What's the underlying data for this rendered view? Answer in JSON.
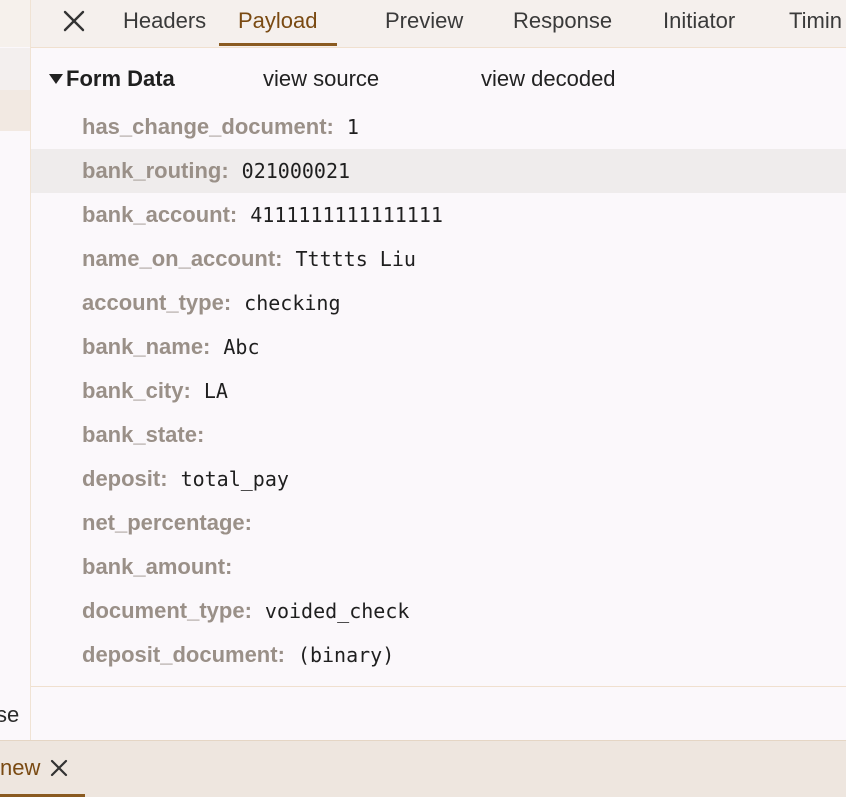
{
  "tabs": [
    {
      "label": "Headers",
      "active": false
    },
    {
      "label": "Payload",
      "active": true
    },
    {
      "label": "Preview",
      "active": false
    },
    {
      "label": "Response",
      "active": false
    },
    {
      "label": "Initiator",
      "active": false
    },
    {
      "label": "Timin",
      "active": false
    }
  ],
  "form_data": {
    "title": "Form Data",
    "view_source": "view source",
    "view_decoded": "view decoded",
    "fields": [
      {
        "key": "has_change_document:",
        "value": "1"
      },
      {
        "key": "bank_routing:",
        "value": "021000021"
      },
      {
        "key": "bank_account:",
        "value": "4111111111111111"
      },
      {
        "key": "name_on_account:",
        "value": "Ttttts Liu"
      },
      {
        "key": "account_type:",
        "value": "checking"
      },
      {
        "key": "bank_name:",
        "value": "Abc"
      },
      {
        "key": "bank_city:",
        "value": "LA"
      },
      {
        "key": "bank_state:",
        "value": ""
      },
      {
        "key": "deposit:",
        "value": "total_pay"
      },
      {
        "key": "net_percentage:",
        "value": ""
      },
      {
        "key": "bank_amount:",
        "value": ""
      },
      {
        "key": "document_type:",
        "value": "voided_check"
      },
      {
        "key": "deposit_document:",
        "value": "(binary)"
      }
    ]
  },
  "left_strip_text": "se",
  "bottom_tab": {
    "label": "new"
  },
  "icons": {
    "close": "close-icon",
    "expand": "triangle-down-icon"
  },
  "colors": {
    "accent": "#8a5a20",
    "key_text": "#9a9088",
    "highlight_row": "#efecec"
  }
}
